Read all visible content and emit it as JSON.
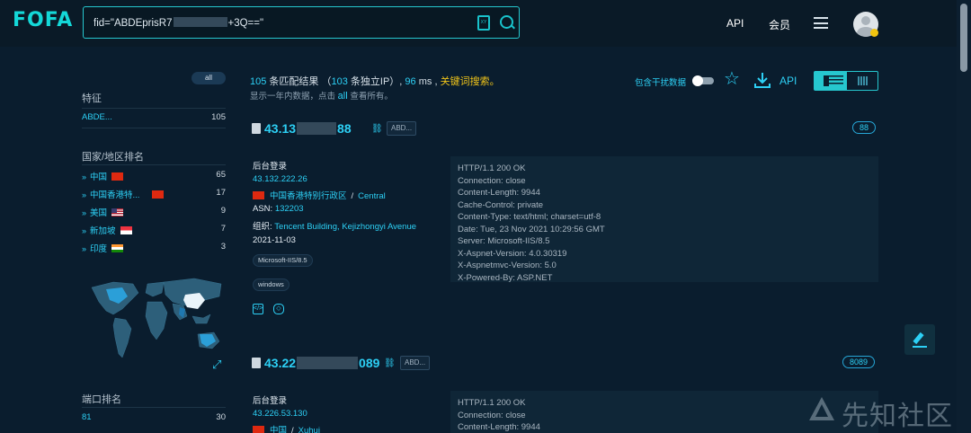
{
  "header": {
    "logo": "FOFA",
    "search_before": "fid=\"ABDEprisR7",
    "search_after": "+3Q==\"",
    "nav_api": "API",
    "nav_member": "会员"
  },
  "sidebar": {
    "all_label": "all",
    "feature_heading": "特征",
    "feature_items": [
      {
        "label": "ABDE...",
        "count": "105"
      }
    ],
    "country_heading": "国家/地区排名",
    "countries": [
      {
        "label": "中国",
        "count": "65",
        "flag": "cn"
      },
      {
        "label": "中国香港特...",
        "count": "17",
        "flag": "hk"
      },
      {
        "label": "美国",
        "count": "9",
        "flag": "us"
      },
      {
        "label": "新加坡",
        "count": "7",
        "flag": "sg"
      },
      {
        "label": "印度",
        "count": "3",
        "flag": "in"
      }
    ],
    "port_heading": "端口排名",
    "ports": [
      {
        "label": "81",
        "count": "30"
      }
    ]
  },
  "summary": {
    "total": "105",
    "total_text": "条匹配结果",
    "open_paren": "（",
    "unique_ips": "103",
    "unique_text": "条独立IP）,",
    "time": "96",
    "time_unit": "ms ,",
    "keyword_search": "关键词搜索。",
    "note_prefix": "显示一年内数据，点击",
    "note_all": "all",
    "note_suffix": "查看所有。"
  },
  "toolbar": {
    "include_label": "包含干扰数据",
    "api_label": "API"
  },
  "results": [
    {
      "ip_prefix": "43.13",
      "ip_suffix": "88",
      "tag": "ABD...",
      "port": "88",
      "title": "后台登录",
      "link": "43.132.222.26",
      "region": "中国香港特别行政区",
      "city": "Central",
      "asn_label": "ASN:",
      "asn": "132203",
      "org_label": "组织:",
      "org": "Tencent Building, Kejizhongyi Avenue",
      "date": "2021-11-03",
      "pills": [
        "Microsoft-IIS/8.5",
        "windows"
      ],
      "response": [
        "HTTP/1.1 200 OK",
        "Connection: close",
        "Content-Length: 9944",
        "Cache-Control: private",
        "Content-Type: text/html; charset=utf-8",
        "Date: Tue, 23 Nov 2021 10:29:56 GMT",
        "Server: Microsoft-IIS/8.5",
        "X-Aspnet-Version: 4.0.30319",
        "X-Aspnetmvc-Version: 5.0",
        "X-Powered-By: ASP.NET"
      ]
    },
    {
      "ip_prefix": "43.22",
      "ip_suffix": "089",
      "tag": "ABD...",
      "port": "8089",
      "title": "后台登录",
      "link": "43.226.53.130",
      "region": "中国",
      "city": "Xuhui",
      "response": [
        "HTTP/1.1 200 OK",
        "Connection: close",
        "Content-Length: 9944"
      ]
    }
  ],
  "watermark": "先知社区",
  "colors": {
    "accent": "#2dd0f5",
    "background": "#0a1d2e",
    "keyword": "#f0c419"
  }
}
